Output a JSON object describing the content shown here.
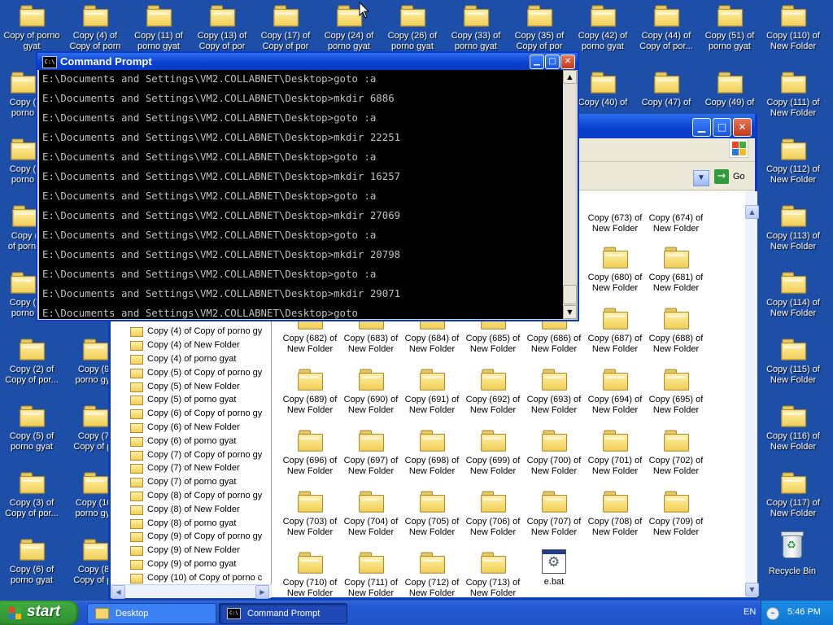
{
  "desktop": {
    "icons": [
      {
        "label": "Copy of porno\ngyat"
      },
      {
        "label": "Copy (4) of\nCopy of porn"
      },
      {
        "label": "Copy (11) of\nporno gyat"
      },
      {
        "label": "Copy (13) of\nCopy of por"
      },
      {
        "label": "Copy (17) of\nCopy of por"
      },
      {
        "label": "Copy (24) of\nporno gyat"
      },
      {
        "label": "Copy (26) of\nporno gyat"
      },
      {
        "label": "Copy (33) of\nporno gyat"
      },
      {
        "label": "Copy (35) of\nCopy of por"
      },
      {
        "label": "Copy (42) of\nporno gyat"
      },
      {
        "label": "Copy (44) of\nCopy of por..."
      },
      {
        "label": "Copy (51) of\nporno gyat"
      },
      {
        "label": "Copy (110) of\nNew Folder"
      },
      {
        "label": "Copy (\nporno"
      },
      {
        "label": "Copy (40) of"
      },
      {
        "label": "Copy (47) of"
      },
      {
        "label": "Copy (49) of"
      },
      {
        "label": "Copy (111) of\nNew Folder"
      },
      {
        "label": "Copy (\nporno"
      },
      {
        "label": "Copy (112) of\nNew Folder"
      },
      {
        "label": "Copy (\nof porno"
      },
      {
        "label": "Copy (113) of\nNew Folder"
      },
      {
        "label": "Copy (\nporno"
      },
      {
        "label": "Copy (114) of\nNew Folder"
      },
      {
        "label": "Copy (2) of\nCopy of por..."
      },
      {
        "label": "Copy (9)\nporno gya"
      },
      {
        "label": "Copy (115) of\nNew Folder"
      },
      {
        "label": "Copy (5) of\nporno gyat"
      },
      {
        "label": "Copy (7)\nCopy of po"
      },
      {
        "label": "Copy (116) of\nNew Folder"
      },
      {
        "label": "Copy (3) of\nCopy of por..."
      },
      {
        "label": "Copy (10)\nporno gya"
      },
      {
        "label": "Copy (117) of\nNew Folder"
      },
      {
        "label": "Copy (6) of\nporno gyat"
      },
      {
        "label": "Copy (8)\nCopy of po"
      }
    ],
    "recycle_bin": "Recycle Bin"
  },
  "cmd": {
    "title": "Command Prompt",
    "icon_text": "C:\\",
    "lines": [
      "E:\\Documents and Settings\\VM2.COLLABNET\\Desktop>goto :a",
      "E:\\Documents and Settings\\VM2.COLLABNET\\Desktop>mkdir 6886",
      "E:\\Documents and Settings\\VM2.COLLABNET\\Desktop>goto :a",
      "E:\\Documents and Settings\\VM2.COLLABNET\\Desktop>mkdir 22251",
      "E:\\Documents and Settings\\VM2.COLLABNET\\Desktop>goto :a",
      "E:\\Documents and Settings\\VM2.COLLABNET\\Desktop>mkdir 16257",
      "E:\\Documents and Settings\\VM2.COLLABNET\\Desktop>goto :a",
      "E:\\Documents and Settings\\VM2.COLLABNET\\Desktop>mkdir 27069",
      "E:\\Documents and Settings\\VM2.COLLABNET\\Desktop>goto :a",
      "E:\\Documents and Settings\\VM2.COLLABNET\\Desktop>mkdir 20798",
      "E:\\Documents and Settings\\VM2.COLLABNET\\Desktop>goto :a",
      "E:\\Documents and Settings\\VM2.COLLABNET\\Desktop>mkdir 29071",
      "E:\\Documents and Settings\\VM2.COLLABNET\\Desktop>goto"
    ]
  },
  "explorer": {
    "go_label": "Go",
    "tree_items": [
      "Copy (4) of Copy of porno gy",
      "Copy (4) of New Folder",
      "Copy (4) of porno gyat",
      "Copy (5) of Copy of porno gy",
      "Copy (5) of New Folder",
      "Copy (5) of porno gyat",
      "Copy (6) of Copy of porno gy",
      "Copy (6) of New Folder",
      "Copy (6) of porno gyat",
      "Copy (7) of Copy of porno gy",
      "Copy (7) of New Folder",
      "Copy (7) of porno gyat",
      "Copy (8) of Copy of porno gy",
      "Copy (8) of New Folder",
      "Copy (8) of porno gyat",
      "Copy (9) of Copy of porno gy",
      "Copy (9) of New Folder",
      "Copy (9) of porno gyat",
      "Copy (10) of Copy of porno c"
    ],
    "folders": [
      "Copy (673) of\nNew Folder",
      "Copy (674) of\nNew Folder",
      "Copy (680) of\nNew Folder",
      "Copy (681) of\nNew Folder",
      "Copy (682) of\nNew Folder",
      "Copy (683) of\nNew Folder",
      "Copy (684) of\nNew Folder",
      "Copy (685) of\nNew Folder",
      "Copy (686) of\nNew Folder",
      "Copy (687) of\nNew Folder",
      "Copy (688) of\nNew Folder",
      "Copy (689) of\nNew Folder",
      "Copy (690) of\nNew Folder",
      "Copy (691) of\nNew Folder",
      "Copy (692) of\nNew Folder",
      "Copy (693) of\nNew Folder",
      "Copy (694) of\nNew Folder",
      "Copy (695) of\nNew Folder",
      "Copy (696) of\nNew Folder",
      "Copy (697) of\nNew Folder",
      "Copy (698) of\nNew Folder",
      "Copy (699) of\nNew Folder",
      "Copy (700) of\nNew Folder",
      "Copy (701) of\nNew Folder",
      "Copy (702) of\nNew Folder",
      "Copy (703) of\nNew Folder",
      "Copy (704) of\nNew Folder",
      "Copy (705) of\nNew Folder",
      "Copy (706) of\nNew Folder",
      "Copy (707) of\nNew Folder",
      "Copy (708) of\nNew Folder",
      "Copy (709) of\nNew Folder",
      "Copy (710) of\nNew Folder",
      "Copy (711) of\nNew Folder",
      "Copy (712) of\nNew Folder",
      "Copy (713) of\nNew Folder"
    ],
    "bat_file": "e.bat"
  },
  "taskbar": {
    "start_label": "start",
    "tasks": [
      {
        "label": "Desktop"
      },
      {
        "label": "Command Prompt"
      }
    ],
    "language": "EN",
    "clock": "5:46 PM"
  }
}
